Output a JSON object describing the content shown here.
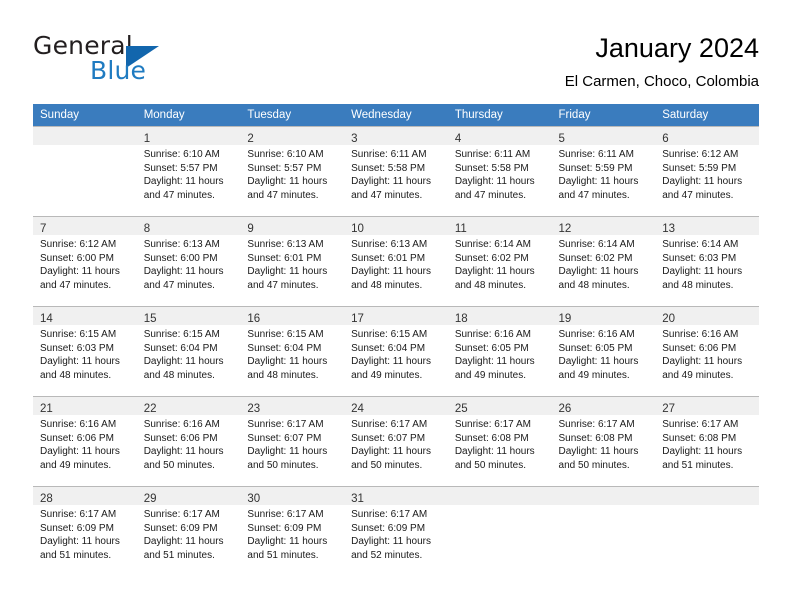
{
  "brand": {
    "name_part1": "General",
    "name_part2": "Blue",
    "triangle_color": "#1266ad",
    "blue_color": "#1f7bc1"
  },
  "header": {
    "title": "January 2024",
    "subtitle": "El Carmen, Choco, Colombia"
  },
  "theme": {
    "header_row_bg": "#3a7cbe",
    "header_row_text": "#ffffff",
    "daynum_band_bg": "#f0f0f0",
    "grid_line": "#c8c8c8"
  },
  "weekday_headers": [
    "Sunday",
    "Monday",
    "Tuesday",
    "Wednesday",
    "Thursday",
    "Friday",
    "Saturday"
  ],
  "weeks": [
    [
      {
        "day": "",
        "lines": []
      },
      {
        "day": "1",
        "lines": [
          "Sunrise: 6:10 AM",
          "Sunset: 5:57 PM",
          "Daylight: 11 hours",
          "and 47 minutes."
        ]
      },
      {
        "day": "2",
        "lines": [
          "Sunrise: 6:10 AM",
          "Sunset: 5:57 PM",
          "Daylight: 11 hours",
          "and 47 minutes."
        ]
      },
      {
        "day": "3",
        "lines": [
          "Sunrise: 6:11 AM",
          "Sunset: 5:58 PM",
          "Daylight: 11 hours",
          "and 47 minutes."
        ]
      },
      {
        "day": "4",
        "lines": [
          "Sunrise: 6:11 AM",
          "Sunset: 5:58 PM",
          "Daylight: 11 hours",
          "and 47 minutes."
        ]
      },
      {
        "day": "5",
        "lines": [
          "Sunrise: 6:11 AM",
          "Sunset: 5:59 PM",
          "Daylight: 11 hours",
          "and 47 minutes."
        ]
      },
      {
        "day": "6",
        "lines": [
          "Sunrise: 6:12 AM",
          "Sunset: 5:59 PM",
          "Daylight: 11 hours",
          "and 47 minutes."
        ]
      }
    ],
    [
      {
        "day": "7",
        "lines": [
          "Sunrise: 6:12 AM",
          "Sunset: 6:00 PM",
          "Daylight: 11 hours",
          "and 47 minutes."
        ]
      },
      {
        "day": "8",
        "lines": [
          "Sunrise: 6:13 AM",
          "Sunset: 6:00 PM",
          "Daylight: 11 hours",
          "and 47 minutes."
        ]
      },
      {
        "day": "9",
        "lines": [
          "Sunrise: 6:13 AM",
          "Sunset: 6:01 PM",
          "Daylight: 11 hours",
          "and 47 minutes."
        ]
      },
      {
        "day": "10",
        "lines": [
          "Sunrise: 6:13 AM",
          "Sunset: 6:01 PM",
          "Daylight: 11 hours",
          "and 48 minutes."
        ]
      },
      {
        "day": "11",
        "lines": [
          "Sunrise: 6:14 AM",
          "Sunset: 6:02 PM",
          "Daylight: 11 hours",
          "and 48 minutes."
        ]
      },
      {
        "day": "12",
        "lines": [
          "Sunrise: 6:14 AM",
          "Sunset: 6:02 PM",
          "Daylight: 11 hours",
          "and 48 minutes."
        ]
      },
      {
        "day": "13",
        "lines": [
          "Sunrise: 6:14 AM",
          "Sunset: 6:03 PM",
          "Daylight: 11 hours",
          "and 48 minutes."
        ]
      }
    ],
    [
      {
        "day": "14",
        "lines": [
          "Sunrise: 6:15 AM",
          "Sunset: 6:03 PM",
          "Daylight: 11 hours",
          "and 48 minutes."
        ]
      },
      {
        "day": "15",
        "lines": [
          "Sunrise: 6:15 AM",
          "Sunset: 6:04 PM",
          "Daylight: 11 hours",
          "and 48 minutes."
        ]
      },
      {
        "day": "16",
        "lines": [
          "Sunrise: 6:15 AM",
          "Sunset: 6:04 PM",
          "Daylight: 11 hours",
          "and 48 minutes."
        ]
      },
      {
        "day": "17",
        "lines": [
          "Sunrise: 6:15 AM",
          "Sunset: 6:04 PM",
          "Daylight: 11 hours",
          "and 49 minutes."
        ]
      },
      {
        "day": "18",
        "lines": [
          "Sunrise: 6:16 AM",
          "Sunset: 6:05 PM",
          "Daylight: 11 hours",
          "and 49 minutes."
        ]
      },
      {
        "day": "19",
        "lines": [
          "Sunrise: 6:16 AM",
          "Sunset: 6:05 PM",
          "Daylight: 11 hours",
          "and 49 minutes."
        ]
      },
      {
        "day": "20",
        "lines": [
          "Sunrise: 6:16 AM",
          "Sunset: 6:06 PM",
          "Daylight: 11 hours",
          "and 49 minutes."
        ]
      }
    ],
    [
      {
        "day": "21",
        "lines": [
          "Sunrise: 6:16 AM",
          "Sunset: 6:06 PM",
          "Daylight: 11 hours",
          "and 49 minutes."
        ]
      },
      {
        "day": "22",
        "lines": [
          "Sunrise: 6:16 AM",
          "Sunset: 6:06 PM",
          "Daylight: 11 hours",
          "and 50 minutes."
        ]
      },
      {
        "day": "23",
        "lines": [
          "Sunrise: 6:17 AM",
          "Sunset: 6:07 PM",
          "Daylight: 11 hours",
          "and 50 minutes."
        ]
      },
      {
        "day": "24",
        "lines": [
          "Sunrise: 6:17 AM",
          "Sunset: 6:07 PM",
          "Daylight: 11 hours",
          "and 50 minutes."
        ]
      },
      {
        "day": "25",
        "lines": [
          "Sunrise: 6:17 AM",
          "Sunset: 6:08 PM",
          "Daylight: 11 hours",
          "and 50 minutes."
        ]
      },
      {
        "day": "26",
        "lines": [
          "Sunrise: 6:17 AM",
          "Sunset: 6:08 PM",
          "Daylight: 11 hours",
          "and 50 minutes."
        ]
      },
      {
        "day": "27",
        "lines": [
          "Sunrise: 6:17 AM",
          "Sunset: 6:08 PM",
          "Daylight: 11 hours",
          "and 51 minutes."
        ]
      }
    ],
    [
      {
        "day": "28",
        "lines": [
          "Sunrise: 6:17 AM",
          "Sunset: 6:09 PM",
          "Daylight: 11 hours",
          "and 51 minutes."
        ]
      },
      {
        "day": "29",
        "lines": [
          "Sunrise: 6:17 AM",
          "Sunset: 6:09 PM",
          "Daylight: 11 hours",
          "and 51 minutes."
        ]
      },
      {
        "day": "30",
        "lines": [
          "Sunrise: 6:17 AM",
          "Sunset: 6:09 PM",
          "Daylight: 11 hours",
          "and 51 minutes."
        ]
      },
      {
        "day": "31",
        "lines": [
          "Sunrise: 6:17 AM",
          "Sunset: 6:09 PM",
          "Daylight: 11 hours",
          "and 52 minutes."
        ]
      },
      {
        "day": "",
        "lines": []
      },
      {
        "day": "",
        "lines": []
      },
      {
        "day": "",
        "lines": []
      }
    ]
  ]
}
